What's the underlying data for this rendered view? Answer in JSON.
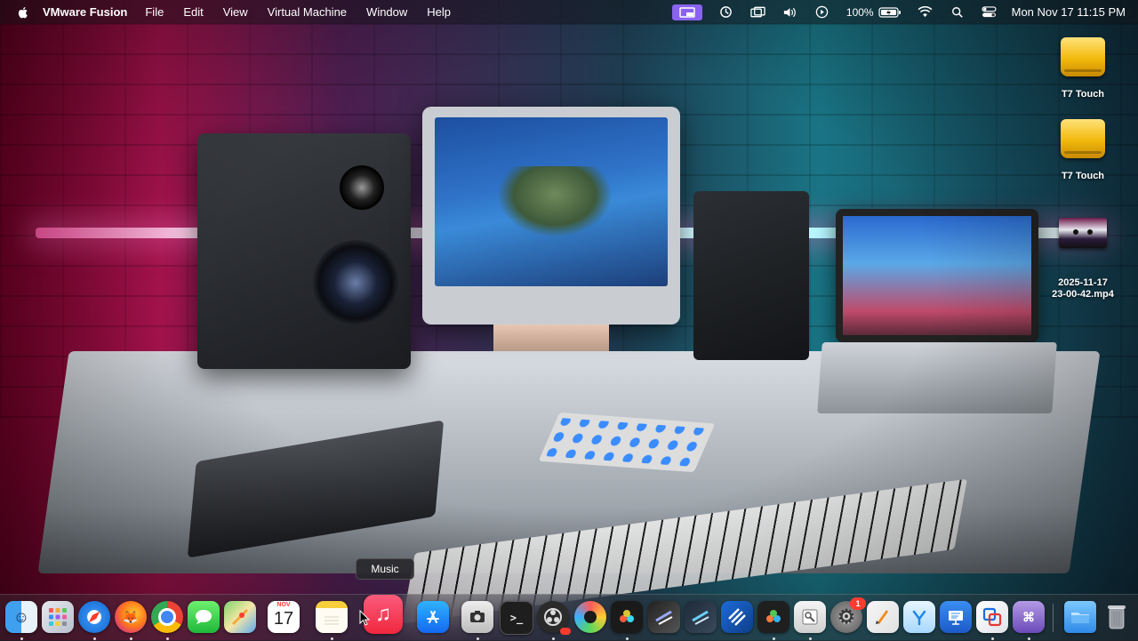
{
  "menubar": {
    "app_name": "VMware Fusion",
    "menus": [
      "File",
      "Edit",
      "View",
      "Virtual Machine",
      "Window",
      "Help"
    ],
    "battery_percent": "100%",
    "datetime": "Mon Nov 17  11:15 PM",
    "status_icons": [
      "vmware-fusion-icon",
      "time-machine-icon",
      "screen-mirroring-icon",
      "volume-icon",
      "now-playing-icon",
      "battery-icon",
      "wifi-icon",
      "spotlight-icon",
      "control-center-icon"
    ]
  },
  "desktop": {
    "items": [
      {
        "label": "T7 Touch",
        "icon": "external-drive-icon"
      },
      {
        "label": "T7 Touch",
        "icon": "external-drive-icon"
      },
      {
        "label": "2025-11-17\n23-00-42.mp4",
        "icon": "video-file-icon"
      }
    ]
  },
  "dock": {
    "tooltip": "Music",
    "calendar": {
      "month": "NOV",
      "day": "17"
    },
    "settings_badge": "1",
    "apps": [
      {
        "name": "Finder",
        "icon": "finder-icon"
      },
      {
        "name": "Launchpad",
        "icon": "launchpad-icon"
      },
      {
        "name": "Safari",
        "icon": "safari-icon"
      },
      {
        "name": "Firefox",
        "icon": "firefox-icon"
      },
      {
        "name": "Chrome",
        "icon": "chrome-icon"
      },
      {
        "name": "Messages",
        "icon": "messages-icon"
      },
      {
        "name": "Maps",
        "icon": "maps-icon"
      },
      {
        "name": "Calendar",
        "icon": "calendar-icon"
      },
      {
        "name": "Notes",
        "icon": "notes-icon"
      },
      {
        "name": "Music",
        "icon": "music-icon"
      },
      {
        "name": "App Store",
        "icon": "app-store-icon"
      },
      {
        "name": "Screenshot",
        "icon": "screenshot-icon"
      },
      {
        "name": "Terminal",
        "icon": "terminal-icon"
      },
      {
        "name": "OBS",
        "icon": "obs-icon"
      },
      {
        "name": "Sublime",
        "icon": "sublime-icon"
      },
      {
        "name": "DaVinci Resolve",
        "icon": "davinci-icon"
      },
      {
        "name": "Final Cut",
        "icon": "final-cut-icon"
      },
      {
        "name": "Logic",
        "icon": "logic-icon"
      },
      {
        "name": "Fusion",
        "icon": "fusion-icon"
      },
      {
        "name": "DaVinci",
        "icon": "davinci-alt-icon"
      },
      {
        "name": "Preview",
        "icon": "preview-icon"
      },
      {
        "name": "System Settings",
        "icon": "settings-icon"
      },
      {
        "name": "Pages",
        "icon": "pages-icon"
      },
      {
        "name": "Xcode",
        "icon": "xcode-icon"
      },
      {
        "name": "Keynote",
        "icon": "keynote-icon"
      },
      {
        "name": "VMware",
        "icon": "vmware-icon"
      },
      {
        "name": "Keyboard",
        "icon": "keyboard-icon"
      },
      {
        "name": "Downloads",
        "icon": "folder-icon"
      },
      {
        "name": "Trash",
        "icon": "trash-icon"
      }
    ]
  }
}
